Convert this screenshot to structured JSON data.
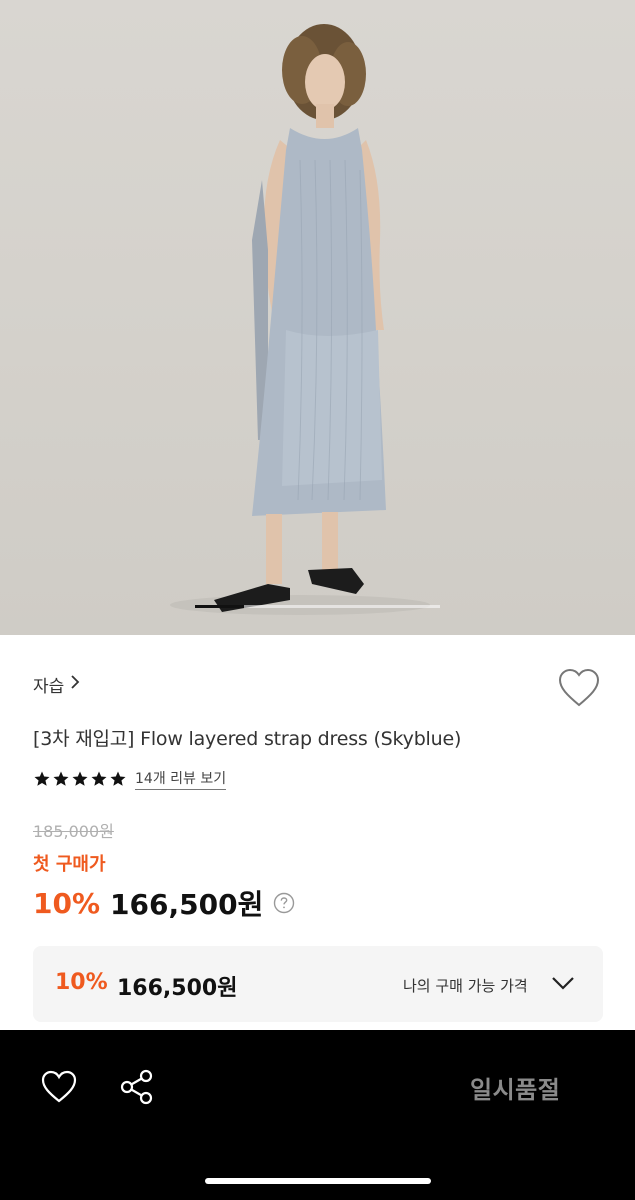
{
  "product": {
    "brand": "자습",
    "title": "[3차 재입고] Flow layered strap dress (Skyblue)",
    "rating_stars": 5,
    "review_link": "14개 리뷰 보기",
    "original_price": "185,000원",
    "first_purchase_label": "첫 구매가",
    "discount": "10%",
    "price": "166,500원"
  },
  "my_price_box": {
    "discount": "10%",
    "price": "166,500원",
    "label": "나의 구매 가능 가격"
  },
  "bottom_bar": {
    "status_button": "일시품절"
  },
  "carousel": {
    "slide_index_fraction": 0.2
  },
  "colors": {
    "accent": "#ef5a1f",
    "bottom_bar": "#000000",
    "soldout_text": "#8a8a8a",
    "dress": "#aeb9c6",
    "background_wall": "#d6d3ce"
  },
  "icons": {
    "brand_chevron": "chevron-right-icon",
    "wishlist": "heart-outline-icon",
    "star": "star-filled-icon",
    "help": "question-circle-icon",
    "dropdown": "chevron-down-icon",
    "share": "share-icon"
  }
}
